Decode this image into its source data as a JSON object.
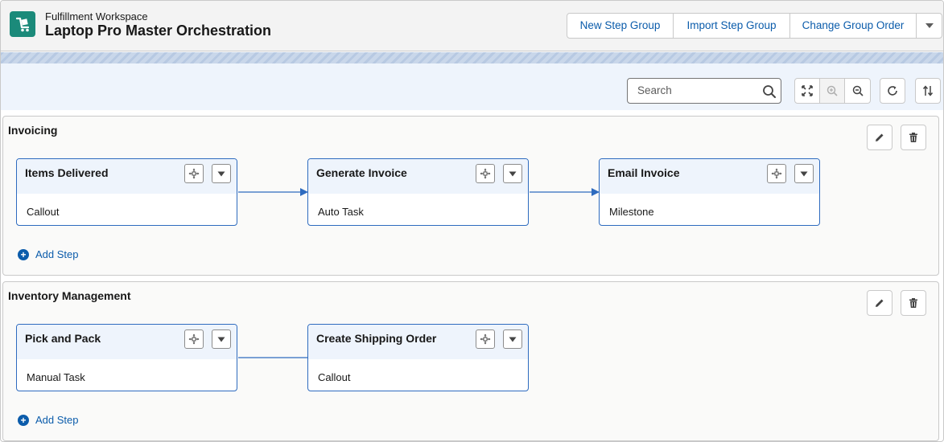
{
  "header": {
    "eyebrow": "Fulfillment Workspace",
    "title": "Laptop Pro Master Orchestration",
    "buttons": {
      "new_step_group": "New Step Group",
      "import_step_group": "Import Step Group",
      "change_group_order": "Change Group Order"
    }
  },
  "toolbar": {
    "search_placeholder": "Search",
    "icons": [
      "fit-to-screen-icon",
      "zoom-in-icon",
      "zoom-out-icon",
      "refresh-icon",
      "sort-icon"
    ]
  },
  "sections": [
    {
      "name": "Invoicing",
      "add_step_label": "Add Step",
      "steps": [
        {
          "name": "Items Delivered",
          "type": "Callout"
        },
        {
          "name": "Generate Invoice",
          "type": "Auto Task"
        },
        {
          "name": "Email Invoice",
          "type": "Milestone"
        }
      ]
    },
    {
      "name": "Inventory Management",
      "add_step_label": "Add Step",
      "steps": [
        {
          "name": "Pick and Pack",
          "type": "Manual Task"
        },
        {
          "name": "Create Shipping Order",
          "type": "Callout"
        }
      ]
    }
  ],
  "colors": {
    "brand_blue": "#0b5cab",
    "card_border": "#2e6bbf",
    "card_header": "#eef4fc",
    "app_icon": "#1b8a7a"
  }
}
